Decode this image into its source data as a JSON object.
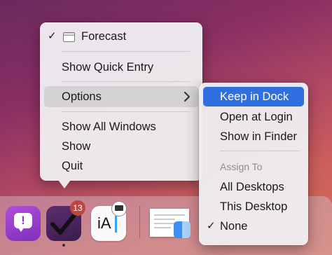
{
  "context_menu": {
    "items": [
      {
        "label": "Forecast",
        "checked": true,
        "icon": "window-icon"
      },
      {
        "label": "Show Quick Entry"
      },
      {
        "label": "Options",
        "submenu": true,
        "highlighted": true
      },
      {
        "label": "Show All Windows"
      },
      {
        "label": "Show"
      },
      {
        "label": "Quit"
      }
    ]
  },
  "submenu": {
    "items": [
      {
        "label": "Keep in Dock",
        "highlighted": true
      },
      {
        "label": "Open at Login"
      },
      {
        "label": "Show in Finder"
      }
    ],
    "section_header": "Assign To",
    "assign_items": [
      {
        "label": "All Desktops"
      },
      {
        "label": "This Desktop"
      },
      {
        "label": "None",
        "checked": true
      }
    ]
  },
  "dock": {
    "badge_count": "13",
    "ia_writer_label": "iA",
    "apps": [
      "feedback-app-icon",
      "omnifocus-app-icon",
      "ia-writer-app-icon",
      "document-stack-icon",
      "finder-icon"
    ]
  },
  "colors": {
    "accent": "#2f6fe0",
    "badge": "#e0453a"
  }
}
